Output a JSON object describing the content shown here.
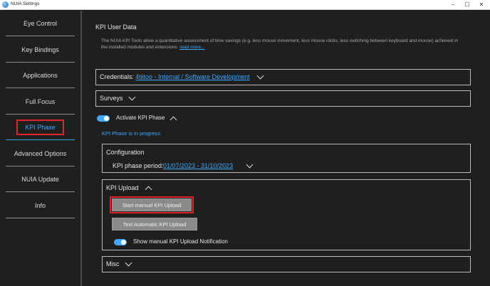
{
  "window": {
    "title": "NUIA Settings",
    "minimize": "–",
    "maximize": "☐",
    "close": "✕"
  },
  "sidebar": {
    "items": [
      {
        "label": "Eye Control"
      },
      {
        "label": "Key Bindings"
      },
      {
        "label": "Applications"
      },
      {
        "label": "Full Focus"
      },
      {
        "label": "KPI Phase",
        "active": true
      },
      {
        "label": "Advanced Options"
      },
      {
        "label": "NUIA Update"
      },
      {
        "label": "Info"
      }
    ]
  },
  "main": {
    "title": "KPI User Data",
    "intro_text": "The NUIA KPI Tools allow a quantitative assessment of time savings (e.g. less mouse movement, less mouse clicks, less switching between keyboard and mouse) achieved in the installed modules and extensions.",
    "intro_link": "read more...",
    "credentials": {
      "label": "Credentials:",
      "value": "4tiitoo - Internal / Software Development"
    },
    "surveys": {
      "label": "Surveys"
    },
    "activate": {
      "label": "Activate KPI Phase",
      "status": "KPI Phase is in progress"
    },
    "configuration": {
      "title": "Configuration",
      "period_label": "KPI phase period:",
      "period_value": "01/07/2023 - 31/10/2023"
    },
    "upload": {
      "title": "KPI Upload",
      "manual_button": "Start manual KPI Upload",
      "auto_button": "Test Automatic KPI Upload",
      "notification_label": "Show manual KPI Upload Notification"
    },
    "misc": {
      "label": "Misc"
    }
  },
  "colors": {
    "accent": "#3fa9ff",
    "highlight": "#e0242c",
    "background": "#1f1f1f"
  }
}
